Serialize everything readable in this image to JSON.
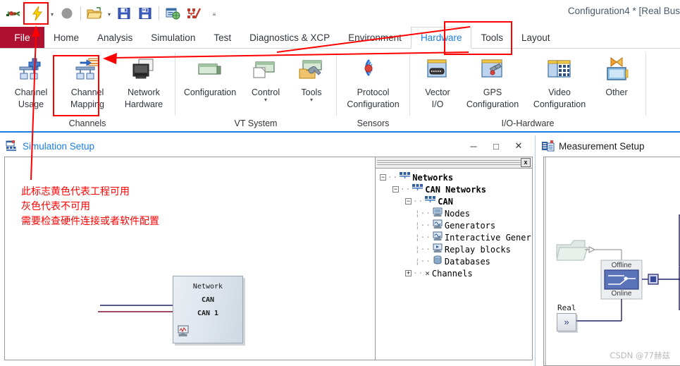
{
  "window": {
    "title": "Configuration4 * [Real Bus"
  },
  "quick_access": {
    "items": [
      {
        "name": "hardware-config-icon",
        "label": "Hardware Configuration"
      },
      {
        "name": "lightning-bolt-icon",
        "label": "Start Measurement"
      },
      {
        "name": "stop-circle-icon",
        "label": "Stop Measurement"
      },
      {
        "name": "open-folder-icon",
        "label": "Open Configuration"
      },
      {
        "name": "save-icon",
        "label": "Save Configuration"
      },
      {
        "name": "save-as-icon",
        "label": "Save Configuration As"
      },
      {
        "name": "copy-config-icon",
        "label": "Copy Configuration"
      },
      {
        "name": "measurement-setup-icon",
        "label": "Measurement Setup"
      },
      {
        "name": "customize-toolbar-icon",
        "label": "Customize Quick Access Toolbar"
      }
    ]
  },
  "ribbon": {
    "file_tab": "File",
    "tabs": [
      {
        "label": "Home",
        "active": false
      },
      {
        "label": "Analysis",
        "active": false
      },
      {
        "label": "Simulation",
        "active": false
      },
      {
        "label": "Test",
        "active": false
      },
      {
        "label": "Diagnostics & XCP",
        "active": false
      },
      {
        "label": "Environment",
        "active": false
      },
      {
        "label": "Hardware",
        "active": true
      },
      {
        "label": "Tools",
        "active": false
      },
      {
        "label": "Layout",
        "active": false
      }
    ],
    "groups": [
      {
        "label": "Channels",
        "items": [
          {
            "icon": "channel-usage-icon",
            "line1": "Channel",
            "line2": "Usage",
            "caret": false
          },
          {
            "icon": "channel-mapping-icon",
            "line1": "Channel",
            "line2": "Mapping",
            "caret": false
          },
          {
            "icon": "network-hardware-icon",
            "line1": "Network",
            "line2": "Hardware",
            "caret": false
          }
        ]
      },
      {
        "label": "VT System",
        "items": [
          {
            "icon": "vt-configuration-icon",
            "line1": "Configuration",
            "line2": "",
            "caret": false
          },
          {
            "icon": "vt-control-icon",
            "line1": "Control",
            "line2": "",
            "caret": true
          },
          {
            "icon": "vt-tools-icon",
            "line1": "Tools",
            "line2": "",
            "caret": true
          }
        ]
      },
      {
        "label": "Sensors",
        "items": [
          {
            "icon": "protocol-configuration-icon",
            "line1": "Protocol",
            "line2": "Configuration",
            "caret": false
          }
        ]
      },
      {
        "label": "I/O-Hardware",
        "items": [
          {
            "icon": "vector-io-icon",
            "line1": "Vector",
            "line2": "I/O",
            "caret": false
          },
          {
            "icon": "gps-configuration-icon",
            "line1": "GPS",
            "line2": "Configuration",
            "caret": false
          },
          {
            "icon": "video-configuration-icon",
            "line1": "Video",
            "line2": "Configuration",
            "caret": false
          },
          {
            "icon": "other-hardware-icon",
            "line1": "Other",
            "line2": "",
            "caret": false
          }
        ]
      }
    ]
  },
  "simulation_setup": {
    "title": "Simulation Setup",
    "controls": {
      "minimize": "─",
      "maximize": "□",
      "close": "✕"
    },
    "network_block": {
      "line1": "Network",
      "line2": "CAN",
      "line3": "CAN  1"
    },
    "tree_close_label": "x",
    "tree": [
      {
        "indent": 0,
        "expander": "−",
        "icon": "network-icon",
        "label": "Networks",
        "bold": true
      },
      {
        "indent": 1,
        "expander": "−",
        "icon": "network-icon",
        "label": "CAN Networks",
        "bold": true
      },
      {
        "indent": 2,
        "expander": "−",
        "icon": "network-icon",
        "label": "CAN",
        "bold": true
      },
      {
        "indent": 3,
        "expander": "",
        "icon": "node-icon",
        "label": "Nodes",
        "bold": false
      },
      {
        "indent": 3,
        "expander": "",
        "icon": "generator-icon",
        "label": "Generators",
        "bold": false
      },
      {
        "indent": 3,
        "expander": "",
        "icon": "interactive-generator-icon",
        "label": "Interactive Gener",
        "bold": false
      },
      {
        "indent": 3,
        "expander": "",
        "icon": "replay-block-icon",
        "label": "Replay blocks",
        "bold": false
      },
      {
        "indent": 3,
        "expander": "",
        "icon": "database-icon",
        "label": "Databases",
        "bold": false
      },
      {
        "indent": 2,
        "expander": "+",
        "icon": "channel-icon",
        "label": "Channels",
        "bold": false
      }
    ]
  },
  "measurement_setup": {
    "title": "Measurement Setup",
    "switch_top_label": "Offline",
    "switch_bottom_label": "Online",
    "real_label": "Real",
    "real_button_label": "»"
  },
  "annotations": {
    "note_lines": [
      "此标志黄色代表工程可用",
      "灰色代表不可用",
      "需要检查硬件连接或者软件配置"
    ],
    "highlight_color": "#ff0000"
  },
  "watermark": "CSDN @77赫兹"
}
